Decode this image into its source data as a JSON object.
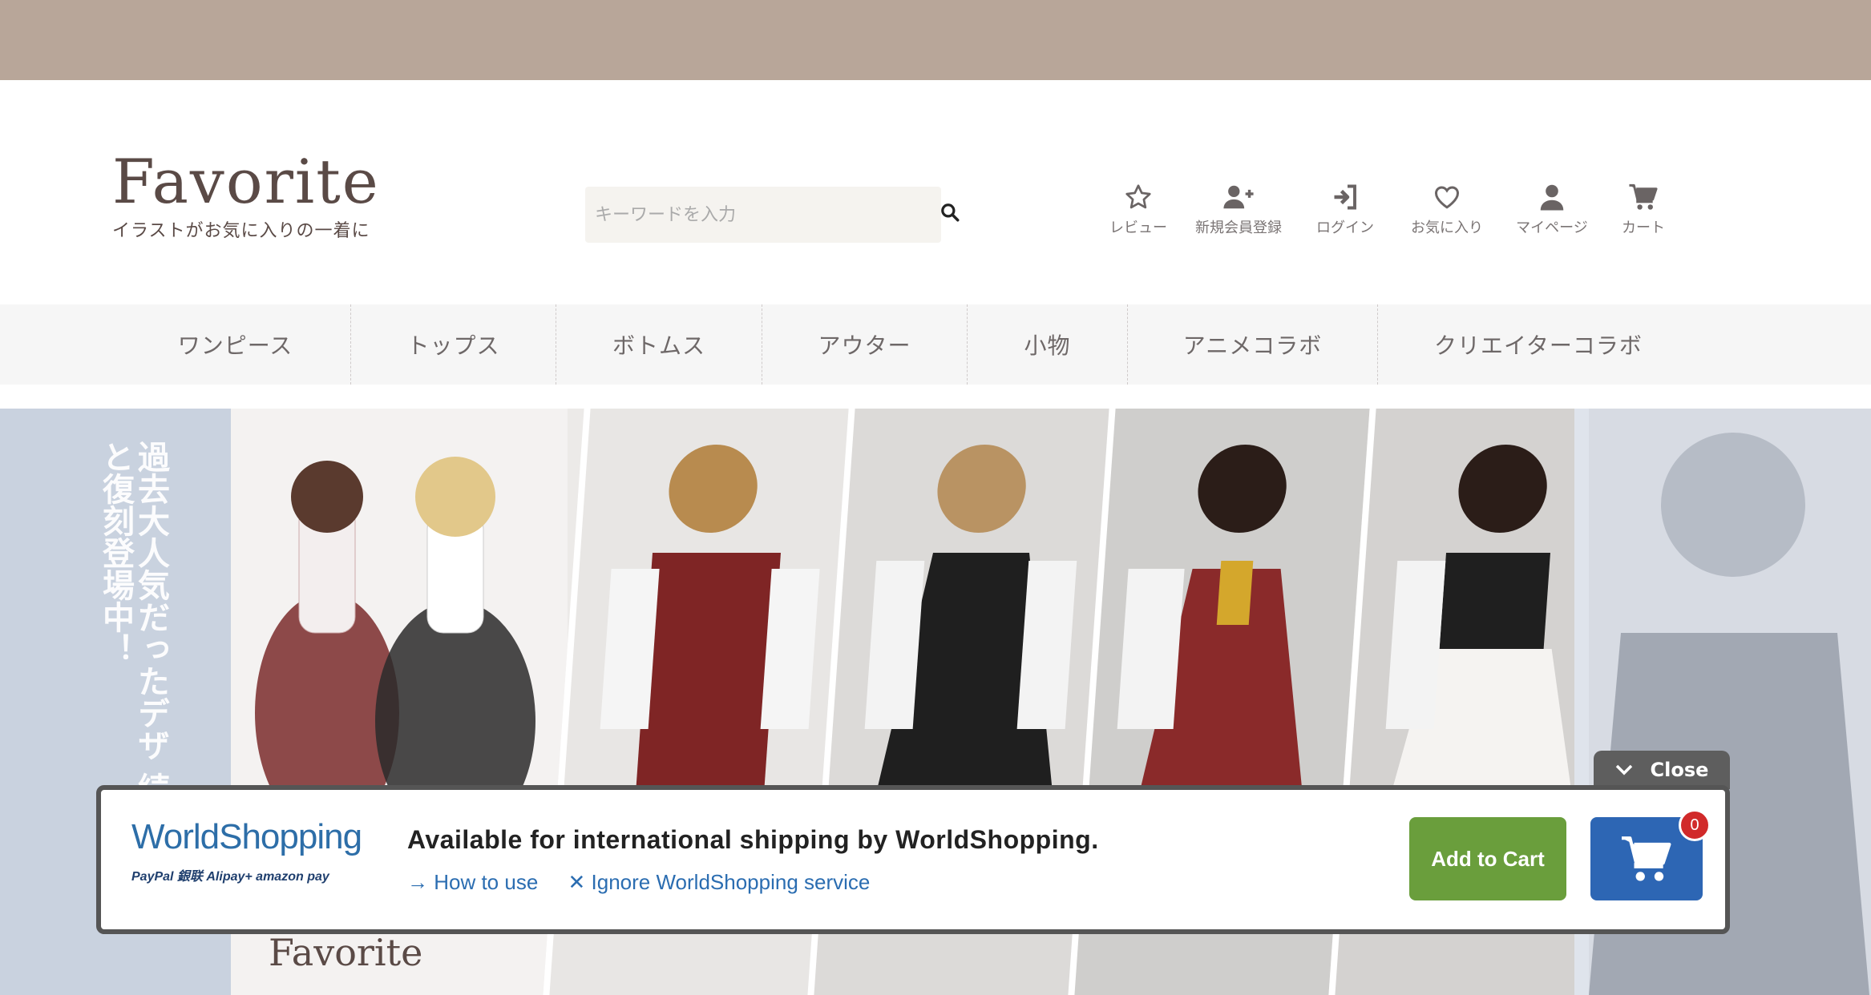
{
  "header": {
    "logo_text": "Favorite",
    "tagline": "イラストがお気に入りの一着に",
    "search_placeholder": "キーワードを入力",
    "icons": [
      {
        "label": "レビュー",
        "icon": "star-icon"
      },
      {
        "label": "新規会員登録",
        "icon": "user-plus-icon"
      },
      {
        "label": "ログイン",
        "icon": "login-icon"
      },
      {
        "label": "お気に入り",
        "icon": "heart-icon"
      },
      {
        "label": "マイページ",
        "icon": "user-icon"
      },
      {
        "label": "カート",
        "icon": "cart-icon"
      }
    ]
  },
  "categories": [
    "ワンピース",
    "トップス",
    "ボトムス",
    "アウター",
    "小物",
    "アニメコラボ",
    "クリエイターコラボ"
  ],
  "banner": {
    "vertical_text": "過去大人気だったデザ 続々と復刻登場中！",
    "bottom_logo": "Favorite"
  },
  "worldshopping": {
    "close_label": "Close",
    "logo_text": "WorldShopping",
    "payments": "PayPal  銀联  Alipay+  amazon pay",
    "title": "Available for international shipping by WorldShopping.",
    "how_to_use": "→ How to use",
    "ignore": "✕ Ignore WorldShopping service",
    "add_to_cart": "Add to Cart",
    "cart_count": "0"
  },
  "colors": {
    "topbar": "#b8a699",
    "add_to_cart": "#6a9e3c",
    "cart_button": "#2d66b4",
    "badge": "#d12a2a",
    "link": "#2b6db1"
  }
}
